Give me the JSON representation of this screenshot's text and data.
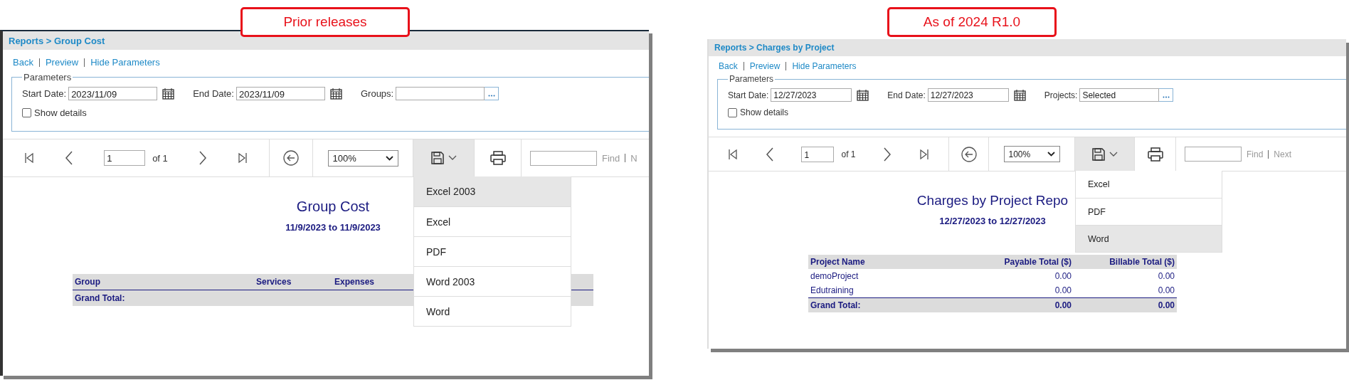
{
  "panels": [
    {
      "callout": "Prior releases",
      "breadcrumb": "Reports > Group Cost",
      "links": [
        "Back",
        "Preview",
        "Hide Parameters"
      ],
      "parameters": {
        "legend": "Parameters",
        "fields": [
          {
            "label": "Start Date:",
            "value": "2023/11/09",
            "kind": "date"
          },
          {
            "label": "End Date:",
            "value": "2023/11/09",
            "kind": "date"
          },
          {
            "label": "Groups:",
            "kind": "picker"
          }
        ],
        "show_details": {
          "label": "Show details",
          "checked": false
        }
      },
      "toolbar": {
        "page": "1",
        "page_count": "of 1",
        "zoom": "100%",
        "find": "Find",
        "next": "N"
      },
      "export_menu": [
        {
          "label": "Excel 2003",
          "selected": true
        },
        {
          "label": "Excel",
          "selected": false
        },
        {
          "label": "PDF",
          "selected": false
        },
        {
          "label": "Word 2003",
          "selected": false
        },
        {
          "label": "Word",
          "selected": false
        }
      ],
      "report": {
        "title": "Group Cost",
        "subtitle": "11/9/2023 to 11/9/2023",
        "columns": [
          "Group",
          "Services",
          "Expenses"
        ],
        "total": {
          "label": "Grand Total:"
        }
      }
    },
    {
      "callout": "As of 2024 R1.0",
      "breadcrumb": "Reports > Charges by Project",
      "links": [
        "Back",
        "Preview",
        "Hide Parameters"
      ],
      "parameters": {
        "legend": "Parameters",
        "fields": [
          {
            "label": "Start Date:",
            "value": "12/27/2023",
            "kind": "date"
          },
          {
            "label": "End Date:",
            "value": "12/27/2023",
            "kind": "date"
          },
          {
            "label": "Projects:",
            "value": "Selected",
            "kind": "picker"
          }
        ],
        "show_details": {
          "label": "Show details",
          "checked": false
        }
      },
      "toolbar": {
        "page": "1",
        "page_count": "of 1",
        "zoom": "100%",
        "find": "Find",
        "next": "Next"
      },
      "export_menu": [
        {
          "label": "Excel",
          "selected": false
        },
        {
          "label": "PDF",
          "selected": false
        },
        {
          "label": "Word",
          "selected": true
        }
      ],
      "report": {
        "title": "Charges by Project Repo",
        "subtitle": "12/27/2023 to 12/27/2023",
        "columns": [
          "Project Name",
          "Payable Total ($)",
          "Billable Total ($)"
        ],
        "rows": [
          [
            "demoProject",
            "0.00",
            "0.00"
          ],
          [
            "Edutraining",
            "0.00",
            "0.00"
          ]
        ],
        "total": {
          "label": "Grand Total:",
          "values": [
            "0.00",
            "0.00"
          ]
        }
      }
    }
  ]
}
